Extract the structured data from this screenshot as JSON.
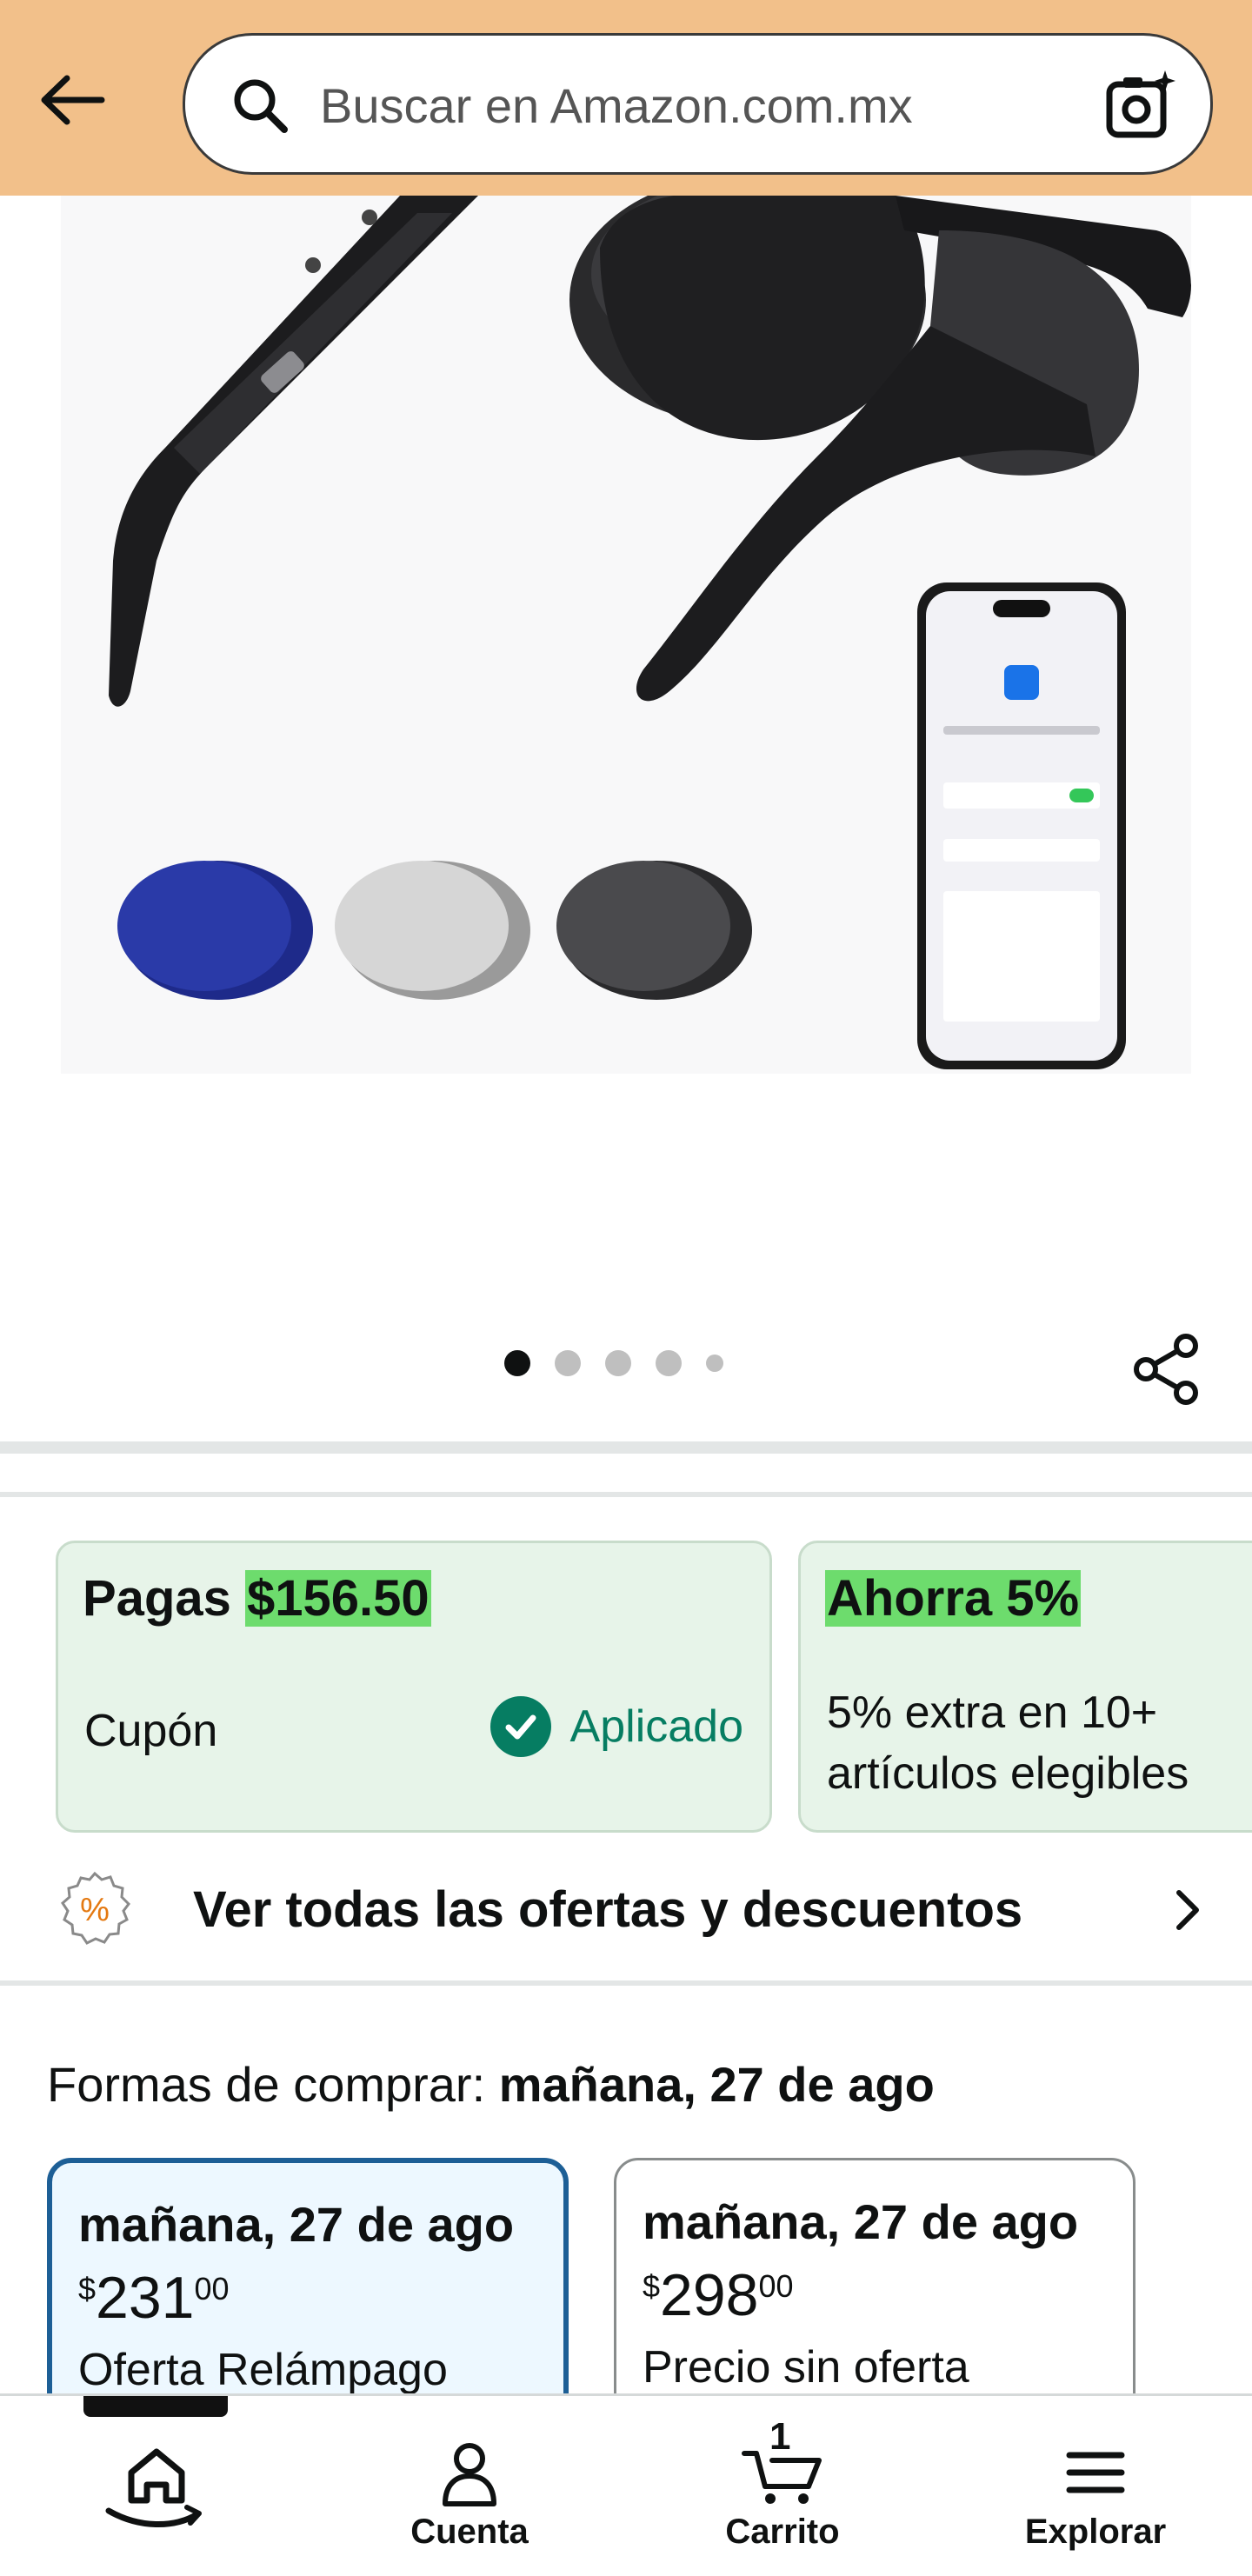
{
  "header": {
    "search_placeholder": "Buscar en Amazon.com.mx",
    "background_color": "#f2c08a",
    "icons": [
      "back-arrow-icon",
      "search-icon",
      "camera-search-icon"
    ]
  },
  "hero": {
    "image_description_icon": "smart-glasses-product-image",
    "carousel": {
      "count": 5,
      "active_index": 0
    },
    "share_icon": "share-icon"
  },
  "offers": {
    "pay_card": {
      "label": "Pagas",
      "amount": "$156.50",
      "coupon_label": "Cupón",
      "status": "Aplicado"
    },
    "save_card": {
      "title": "Ahorra 5%",
      "description": "5% extra en 10+ artículos elegibles"
    },
    "all_offers_text": "Ver todas las ofertas y descuentos",
    "accent_color": "#067d62",
    "highlight_color": "#6ddc6d"
  },
  "ways_to_buy": {
    "prefix": "Formas de comprar: ",
    "date": "mañana, 27 de ago",
    "options": [
      {
        "date": "mañana, 27 de ago",
        "currency": "$",
        "whole": "231",
        "cents": "00",
        "type": "Oferta Relámpago",
        "selected": true
      },
      {
        "date": "mañana, 27 de ago",
        "currency": "$",
        "whole": "298",
        "cents": "00",
        "type": "Precio sin oferta",
        "selected": false
      }
    ]
  },
  "bottom_nav": {
    "home": {
      "icon": "home-icon"
    },
    "account": {
      "label": "Cuenta",
      "icon": "account-icon"
    },
    "cart": {
      "label": "Carrito",
      "count": "1",
      "icon": "cart-icon"
    },
    "menu": {
      "label": "Explorar",
      "icon": "menu-icon"
    }
  }
}
